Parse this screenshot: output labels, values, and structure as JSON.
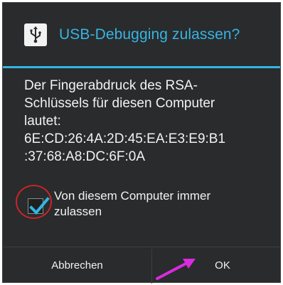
{
  "dialog": {
    "title": "USB-Debugging zulassen?",
    "icon": "usb-icon",
    "message_lines": [
      "Der Fingerabdruck des RSA-",
      "Schlüssels für diesen Computer",
      "lautet:",
      "6E:CD:26:4A:2D:45:EA:E3:E9:B1",
      ":37:68:A8:DC:6F:0A"
    ],
    "checkbox": {
      "label_lines": [
        "Von diesem Computer immer",
        "zulassen"
      ],
      "checked": true
    },
    "buttons": {
      "cancel_label": "Abbrechen",
      "ok_label": "OK"
    }
  },
  "colors": {
    "background": "#292b2c",
    "title": "#36b4e4",
    "divider": "#33b5e5",
    "text": "#f2f2f2",
    "annotation_circle": "#c9242a",
    "annotation_arrow": "#d92be0"
  }
}
